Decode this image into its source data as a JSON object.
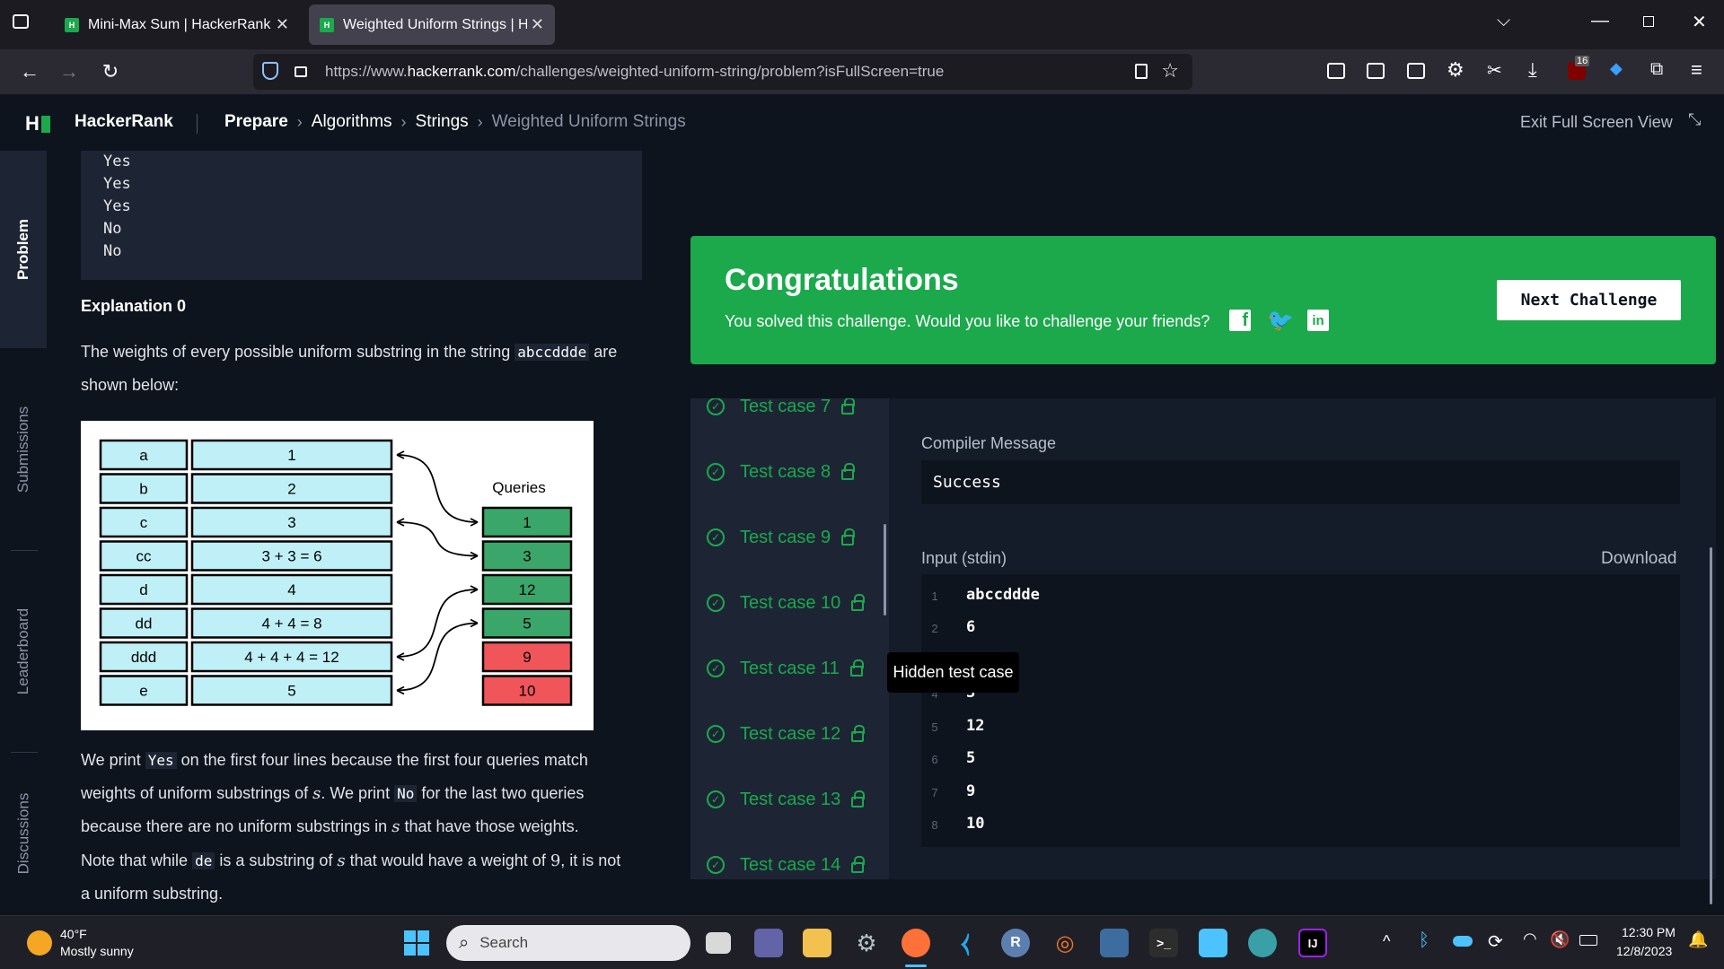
{
  "browser": {
    "tabs": [
      {
        "title": "Mini-Max Sum | HackerRank",
        "active": false
      },
      {
        "title": "Weighted Uniform Strings | Hac",
        "active": true
      }
    ],
    "url_prefix": "https://www.",
    "url_domain": "hackerrank.com",
    "url_path": "/challenges/weighted-uniform-string/problem?isFullScreen=true",
    "badge_count": "16"
  },
  "header": {
    "logo": "H",
    "brand": "HackerRank",
    "breadcrumb": [
      "Prepare",
      "Algorithms",
      "Strings",
      "Weighted Uniform Strings"
    ],
    "exit_fullscreen": "Exit Full Screen View"
  },
  "rail": {
    "problem": "Problem",
    "submissions": "Submissions",
    "leaderboard": "Leaderboard",
    "discussions": "Discussions"
  },
  "problem": {
    "output_lines": [
      "Yes",
      "Yes",
      "Yes",
      "No",
      "No"
    ],
    "explanation_title": "Explanation 0",
    "p1_a": "The weights of every possible uniform substring in the string ",
    "p1_code": "abccddde",
    "p1_b": " are",
    "p1_c": "shown below:",
    "p2_a": "We print ",
    "p2_code1": "Yes",
    "p2_b": " on the first four lines because the first four queries match",
    "p2_c": "weights of uniform substrings of ",
    "p2_var": "s",
    "p2_d": ". We print ",
    "p2_code2": "No",
    "p2_e": " for the last two queries",
    "p2_f": "because there are no uniform substrings in ",
    "p2_g": " that have those weights.",
    "p3_a": "Note that while ",
    "p3_code": "de",
    "p3_b": " is a substring of ",
    "p3_c": " that would have a weight of ",
    "p3_num": "9",
    "p3_d": ", it is not",
    "p3_e": "a uniform substring."
  },
  "diagram": {
    "queries_label": "Queries",
    "rows": [
      {
        "key": "a",
        "value": "1"
      },
      {
        "key": "b",
        "value": "2"
      },
      {
        "key": "c",
        "value": "3"
      },
      {
        "key": "cc",
        "value": "3 + 3 = 6"
      },
      {
        "key": "d",
        "value": "4"
      },
      {
        "key": "dd",
        "value": "4 + 4 = 8"
      },
      {
        "key": "ddd",
        "value": "4 + 4 + 4 = 12"
      },
      {
        "key": "e",
        "value": "5"
      }
    ],
    "queries": [
      {
        "value": "1",
        "status": "match"
      },
      {
        "value": "3",
        "status": "match"
      },
      {
        "value": "12",
        "status": "match"
      },
      {
        "value": "5",
        "status": "match"
      },
      {
        "value": "9",
        "status": "no-match"
      },
      {
        "value": "10",
        "status": "no-match"
      }
    ],
    "colors": {
      "cell": "#bff0f8",
      "match": "#3aa66a",
      "no_match": "#f0555a"
    }
  },
  "congrats": {
    "title": "Congratulations",
    "message": "You solved this challenge. Would you like to challenge your friends?",
    "next_button": "Next Challenge"
  },
  "tests": {
    "cases": [
      "Test case 7",
      "Test case 8",
      "Test case 9",
      "Test case 10",
      "Test case 11",
      "Test case 12",
      "Test case 13",
      "Test case 14"
    ],
    "tooltip": "Hidden test case",
    "compiler_label": "Compiler Message",
    "compiler_value": "Success",
    "input_label": "Input (stdin)",
    "download": "Download",
    "input_lines": [
      {
        "n": "1",
        "v": "abccddde"
      },
      {
        "n": "2",
        "v": "6"
      },
      {
        "n": "4",
        "v": "3"
      },
      {
        "n": "5",
        "v": "12"
      },
      {
        "n": "6",
        "v": "5"
      },
      {
        "n": "7",
        "v": "9"
      },
      {
        "n": "8",
        "v": "10"
      }
    ]
  },
  "taskbar": {
    "temp": "40°F",
    "weather": "Mostly sunny",
    "search": "Search",
    "time": "12:30 PM",
    "date": "12/8/2023"
  },
  "accent": "#1ba94c"
}
